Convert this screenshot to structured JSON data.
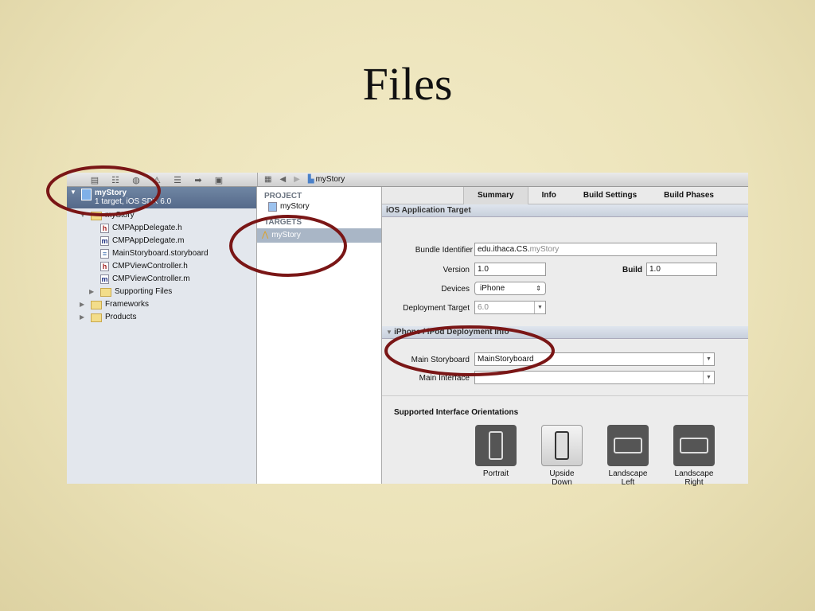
{
  "slide_title": "Files",
  "toolbar": {
    "breadcrumb": "myStory"
  },
  "navigator": {
    "project": {
      "name": "myStory",
      "subtitle": "1 target, iOS SDK 6.0"
    },
    "items": [
      {
        "label": "myStory",
        "type": "folder",
        "indent": 1,
        "expanded": true
      },
      {
        "label": "CMPAppDelegate.h",
        "type": "h",
        "indent": 2
      },
      {
        "label": "CMPAppDelegate.m",
        "type": "m",
        "indent": 2
      },
      {
        "label": "MainStoryboard.storyboard",
        "type": "sb",
        "indent": 2
      },
      {
        "label": "CMPViewController.h",
        "type": "h",
        "indent": 2
      },
      {
        "label": "CMPViewController.m",
        "type": "m",
        "indent": 2
      },
      {
        "label": "Supporting Files",
        "type": "folder",
        "indent": 2,
        "expanded": false
      },
      {
        "label": "Frameworks",
        "type": "folder",
        "indent": 1,
        "expanded": false
      },
      {
        "label": "Products",
        "type": "folder",
        "indent": 1,
        "expanded": false
      }
    ]
  },
  "middle": {
    "project_header": "PROJECT",
    "project_item": "myStory",
    "targets_header": "TARGETS",
    "target_item": "myStory"
  },
  "tabs": [
    "Summary",
    "Info",
    "Build Settings",
    "Build Phases"
  ],
  "ios_target": {
    "header": "iOS Application Target",
    "bundle_label": "Bundle Identifier",
    "bundle_prefix": "edu.ithaca.CS.",
    "bundle_suffix": "myStory",
    "version_label": "Version",
    "version": "1.0",
    "build_label": "Build",
    "build": "1.0",
    "devices_label": "Devices",
    "devices": "iPhone",
    "deploy_label": "Deployment Target",
    "deploy": "6.0"
  },
  "deployment": {
    "header": "iPhone / iPod Deployment Info",
    "storyboard_label": "Main Storyboard",
    "storyboard": "MainStoryboard",
    "interface_label": "Main Interface",
    "interface": ""
  },
  "orientations": {
    "header": "Supported Interface Orientations",
    "items": [
      {
        "label1": "Portrait",
        "label2": "",
        "selected": true
      },
      {
        "label1": "Upside",
        "label2": "Down",
        "selected": false
      },
      {
        "label1": "Landscape",
        "label2": "Left",
        "selected": true
      },
      {
        "label1": "Landscape",
        "label2": "Right",
        "selected": true
      }
    ]
  },
  "annotation_color": "#7a1616"
}
